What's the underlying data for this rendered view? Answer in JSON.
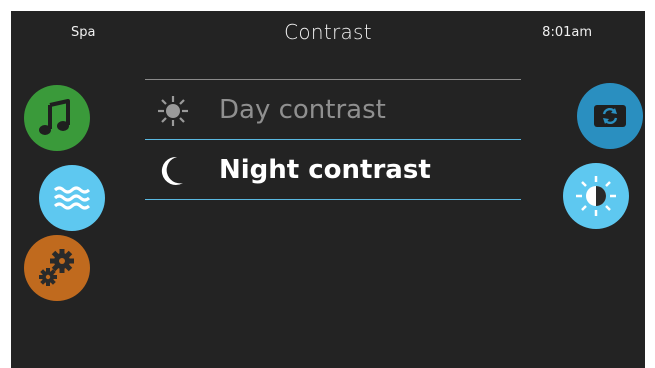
{
  "header": {
    "left_label": "Spa",
    "title": "Contrast",
    "time": "8:01am"
  },
  "options": [
    {
      "label": "Day contrast",
      "icon": "sun-icon",
      "selected": false
    },
    {
      "label": "Night contrast",
      "icon": "moon-icon",
      "selected": true
    }
  ],
  "left_buttons": [
    {
      "icon": "music-note-icon",
      "color": "#3a9a3a"
    },
    {
      "icon": "water-waves-icon",
      "color": "#5ec8f0"
    },
    {
      "icon": "gears-icon",
      "color": "#c06a1e"
    }
  ],
  "right_buttons": [
    {
      "icon": "sync-icon",
      "color": "#2a8fc0"
    },
    {
      "icon": "contrast-sun-icon",
      "color": "#5ec8f0"
    }
  ],
  "colors": {
    "background": "#232323",
    "accent_line": "#5ab8e0",
    "inactive_text": "#8f8f8f",
    "active_text": "#ffffff"
  }
}
